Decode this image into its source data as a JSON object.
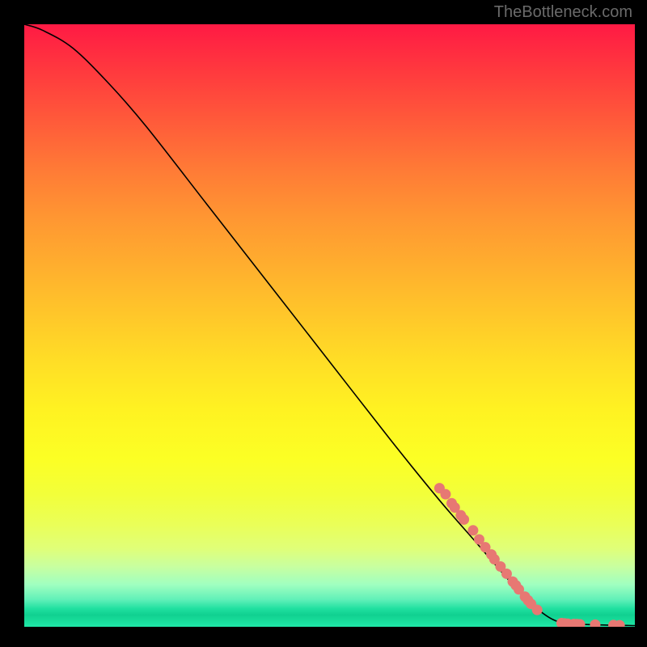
{
  "watermark": "TheBottleneck.com",
  "chart_data": {
    "type": "line",
    "title": "",
    "xlabel": "",
    "ylabel": "",
    "xlim": [
      0,
      100
    ],
    "ylim": [
      0,
      100
    ],
    "curve": [
      {
        "x": 0,
        "y": 100
      },
      {
        "x": 3,
        "y": 99
      },
      {
        "x": 8,
        "y": 96
      },
      {
        "x": 14,
        "y": 90
      },
      {
        "x": 20,
        "y": 83
      },
      {
        "x": 30,
        "y": 70
      },
      {
        "x": 40,
        "y": 57
      },
      {
        "x": 50,
        "y": 44
      },
      {
        "x": 60,
        "y": 31
      },
      {
        "x": 68,
        "y": 21
      },
      {
        "x": 74,
        "y": 14
      },
      {
        "x": 80,
        "y": 7
      },
      {
        "x": 84,
        "y": 3
      },
      {
        "x": 87,
        "y": 1
      },
      {
        "x": 90,
        "y": 0.5
      },
      {
        "x": 95,
        "y": 0.3
      },
      {
        "x": 100,
        "y": 0.2
      }
    ],
    "highlighted_points": [
      {
        "x": 68,
        "y": 23
      },
      {
        "x": 69,
        "y": 22
      },
      {
        "x": 70,
        "y": 20.5
      },
      {
        "x": 70.5,
        "y": 19.8
      },
      {
        "x": 71.5,
        "y": 18.5
      },
      {
        "x": 72,
        "y": 17.8
      },
      {
        "x": 73.5,
        "y": 16
      },
      {
        "x": 74.5,
        "y": 14.5
      },
      {
        "x": 75.5,
        "y": 13.2
      },
      {
        "x": 76.5,
        "y": 12
      },
      {
        "x": 77,
        "y": 11.2
      },
      {
        "x": 78,
        "y": 10
      },
      {
        "x": 79,
        "y": 8.8
      },
      {
        "x": 80,
        "y": 7.5
      },
      {
        "x": 80.5,
        "y": 6.9
      },
      {
        "x": 81,
        "y": 6.2
      },
      {
        "x": 82,
        "y": 5
      },
      {
        "x": 82.5,
        "y": 4.4
      },
      {
        "x": 83,
        "y": 3.8
      },
      {
        "x": 84,
        "y": 2.8
      },
      {
        "x": 88,
        "y": 0.6
      },
      {
        "x": 88.5,
        "y": 0.55
      },
      {
        "x": 89,
        "y": 0.5
      },
      {
        "x": 90,
        "y": 0.45
      },
      {
        "x": 90.5,
        "y": 0.43
      },
      {
        "x": 91,
        "y": 0.4
      },
      {
        "x": 93.5,
        "y": 0.35
      },
      {
        "x": 96.5,
        "y": 0.28
      },
      {
        "x": 97.5,
        "y": 0.25
      }
    ],
    "gradient_stops": [
      {
        "pct": 0,
        "color": "#ff1a44"
      },
      {
        "pct": 50,
        "color": "#ffd428"
      },
      {
        "pct": 80,
        "color": "#f4ff40"
      },
      {
        "pct": 95,
        "color": "#70f4b0"
      },
      {
        "pct": 100,
        "color": "#20e8a8"
      }
    ],
    "point_color": "#e77873",
    "line_color": "#000000"
  }
}
